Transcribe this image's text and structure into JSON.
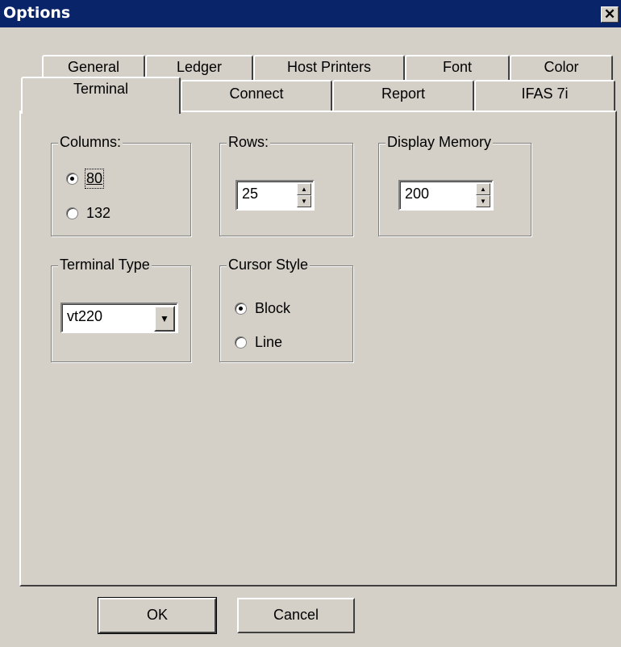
{
  "window": {
    "title": "Options",
    "close_glyph": "✕"
  },
  "tabs": {
    "row1": [
      "General",
      "Ledger",
      "Host Printers",
      "Font",
      "Color"
    ],
    "row2": [
      "Terminal",
      "Connect",
      "Report",
      "IFAS 7i"
    ],
    "active": "Terminal"
  },
  "columns": {
    "label": "Columns:",
    "option_80": "80",
    "option_132": "132",
    "selected": "80"
  },
  "rows": {
    "label": "Rows:",
    "value": "25"
  },
  "display_memory": {
    "label": "Display Memory",
    "value": "200"
  },
  "terminal_type": {
    "label": "Terminal Type",
    "value": "vt220"
  },
  "cursor_style": {
    "label": "Cursor Style",
    "option_block": "Block",
    "option_line": "Line",
    "selected": "Block"
  },
  "buttons": {
    "ok": "OK",
    "cancel": "Cancel"
  },
  "icons": {
    "close": "close-icon",
    "spin_up": "spin-up-icon",
    "spin_down": "spin-down-icon",
    "dropdown": "chevron-down-icon"
  }
}
